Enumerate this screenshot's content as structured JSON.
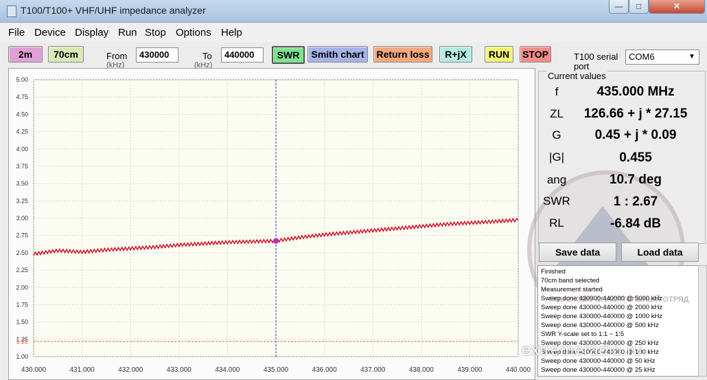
{
  "window": {
    "title": "T100/T100+ VHF/UHF impedance analyzer",
    "min_glyph": "—",
    "max_glyph": "□",
    "close_glyph": "✕"
  },
  "menu": [
    "File",
    "Device",
    "Display",
    "Run",
    "Stop",
    "Options",
    "Help"
  ],
  "toolbar": {
    "band_2m": "2m",
    "band_70cm": "70cm",
    "from_label": "From",
    "from_unit": "(kHz)",
    "from_value": "430000",
    "to_label": "To",
    "to_unit": "(kHz)",
    "to_value": "440000",
    "swr": "SWR",
    "smith": "Smith chart",
    "return_loss": "Return loss",
    "rjx": "R+jX",
    "run": "RUN",
    "stop": "STOP",
    "port_label": "T100 serial port",
    "port_value": "COM6"
  },
  "colors": {
    "band_2m_bg": "#e0a0d6",
    "band_70cm_bg": "#d7eab7",
    "swr_bg": "#7ee28f",
    "smith_bg": "#a7b3e8",
    "return_loss_bg": "#f5a87f",
    "rjx_bg": "#b4ebe4",
    "run_bg": "#f3f37a",
    "stop_bg": "#f58b8b",
    "trace": "#d0021b",
    "marker": "#c030c0",
    "cursor": "#3030c0",
    "threshold": "#e06030"
  },
  "current_values": {
    "title": "Current values",
    "rows": [
      {
        "label": "f",
        "value": "435.000 MHz"
      },
      {
        "label": "ZL",
        "value": "126.66 + j * 27.15"
      },
      {
        "label": "G",
        "value": "0.45 + j * 0.09"
      },
      {
        "label": "|G|",
        "value": "0.455"
      },
      {
        "label": "ang",
        "value": "10.7 deg"
      },
      {
        "label": "SWR",
        "value": "1 : 2.67"
      },
      {
        "label": "RL",
        "value": "-6.84 dB"
      }
    ]
  },
  "buttons": {
    "save": "Save data",
    "load": "Load data"
  },
  "log": [
    "Finished",
    "70cm band selected",
    "Measurement started",
    "Sweep done 430000-440000 @ 5000 kHz",
    "Sweep done 430000-440000 @ 2000 kHz",
    "Sweep done 430000-440000 @ 1000 kHz",
    "Sweep done 430000-440000 @ 500 kHz",
    "SWR Y-scale set to 1:1 ~ 1:5",
    "Sweep done 430000-440000 @ 250 kHz",
    "Sweep done 430000-440000 @ 100 kHz",
    "Sweep done 430000-440000 @ 50 kHz",
    "Sweep done 430000-440000 @ 25 kHz"
  ],
  "watermark": "extremeradio.ru",
  "emblem_text": "ПОИСКОВО-СПАСАТЕЛЬНЫЙ ОТРЯД",
  "chart_data": {
    "type": "line",
    "xlim": [
      430.0,
      440.0
    ],
    "ylim": [
      1.0,
      5.0
    ],
    "x_ticks": [
      "430.000",
      "431.000",
      "432.000",
      "433.000",
      "434.000",
      "435.000",
      "436.000",
      "437.000",
      "438.000",
      "439.000",
      "440.000"
    ],
    "y_ticks": [
      "5.00",
      "4.75",
      "4.50",
      "4.25",
      "4.00",
      "3.75",
      "3.50",
      "3.25",
      "3.00",
      "2.75",
      "2.50",
      "2.25",
      "2.00",
      "1.75",
      "1.50",
      "1.25",
      "1.00"
    ],
    "grid": true,
    "series": [
      {
        "x": [
          430.0,
          430.5,
          431.0,
          431.5,
          432.0,
          432.5,
          433.0,
          433.5,
          434.0,
          434.5,
          435.0,
          435.5,
          436.0,
          436.5,
          437.0,
          437.5,
          438.0,
          438.5,
          439.0,
          439.5,
          440.0
        ],
        "values": [
          2.48,
          2.53,
          2.51,
          2.54,
          2.56,
          2.58,
          2.61,
          2.63,
          2.65,
          2.66,
          2.67,
          2.72,
          2.76,
          2.79,
          2.82,
          2.85,
          2.88,
          2.91,
          2.93,
          2.95,
          2.97
        ]
      }
    ],
    "marker": {
      "x": 435.0,
      "y": 2.67
    },
    "cursor_x": 435.0,
    "threshold": {
      "y": 1.22,
      "label": "1.22"
    }
  }
}
